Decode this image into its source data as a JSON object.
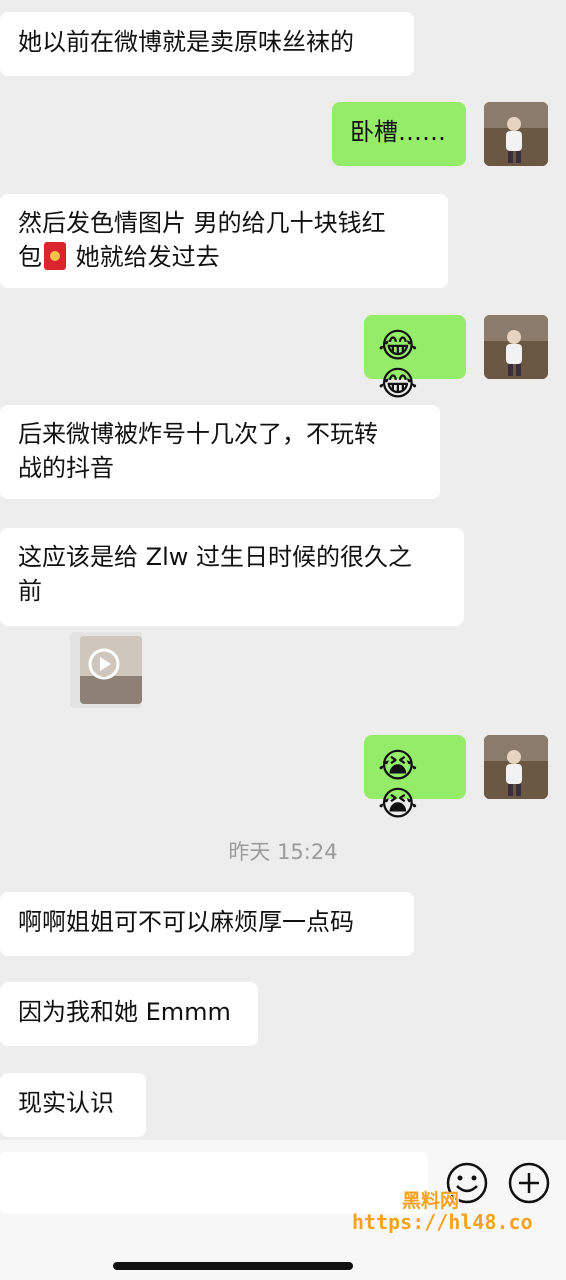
{
  "messages": [
    {
      "text": "她以前在微博就是卖原味丝袜的"
    },
    {
      "text": "卧槽……"
    },
    {
      "text_line1": "然后发色情图片 男的给几十块钱红",
      "text_line2_pre": "包",
      "text_line2_post": " 她就给发过去"
    },
    {
      "emojis": "😂😂"
    },
    {
      "text_line1": "后来微博被炸号十几次了，不玩转",
      "text_line2": "战的抖音"
    },
    {
      "text_line1": "这应该是给 Zlw 过生日时候的很久之",
      "text_line2": "前"
    },
    {
      "emojis": "😭😭"
    },
    {
      "text": "啊啊姐姐可不可以麻烦厚一点码"
    },
    {
      "text": "因为我和她 Emmm"
    },
    {
      "text": "现实认识"
    }
  ],
  "timestamp": "昨天 15:24",
  "watermark": {
    "line1": "黑料网",
    "line2": "https://hl48.co"
  },
  "colors": {
    "my_bubble": "#95ec69",
    "their_bubble": "#ffffff",
    "background": "#ededed"
  },
  "icons": {
    "emoji_button": "smiley-icon",
    "plus_button": "plus-circle-icon",
    "red_packet": "red-envelope-icon",
    "video": "play-icon"
  }
}
